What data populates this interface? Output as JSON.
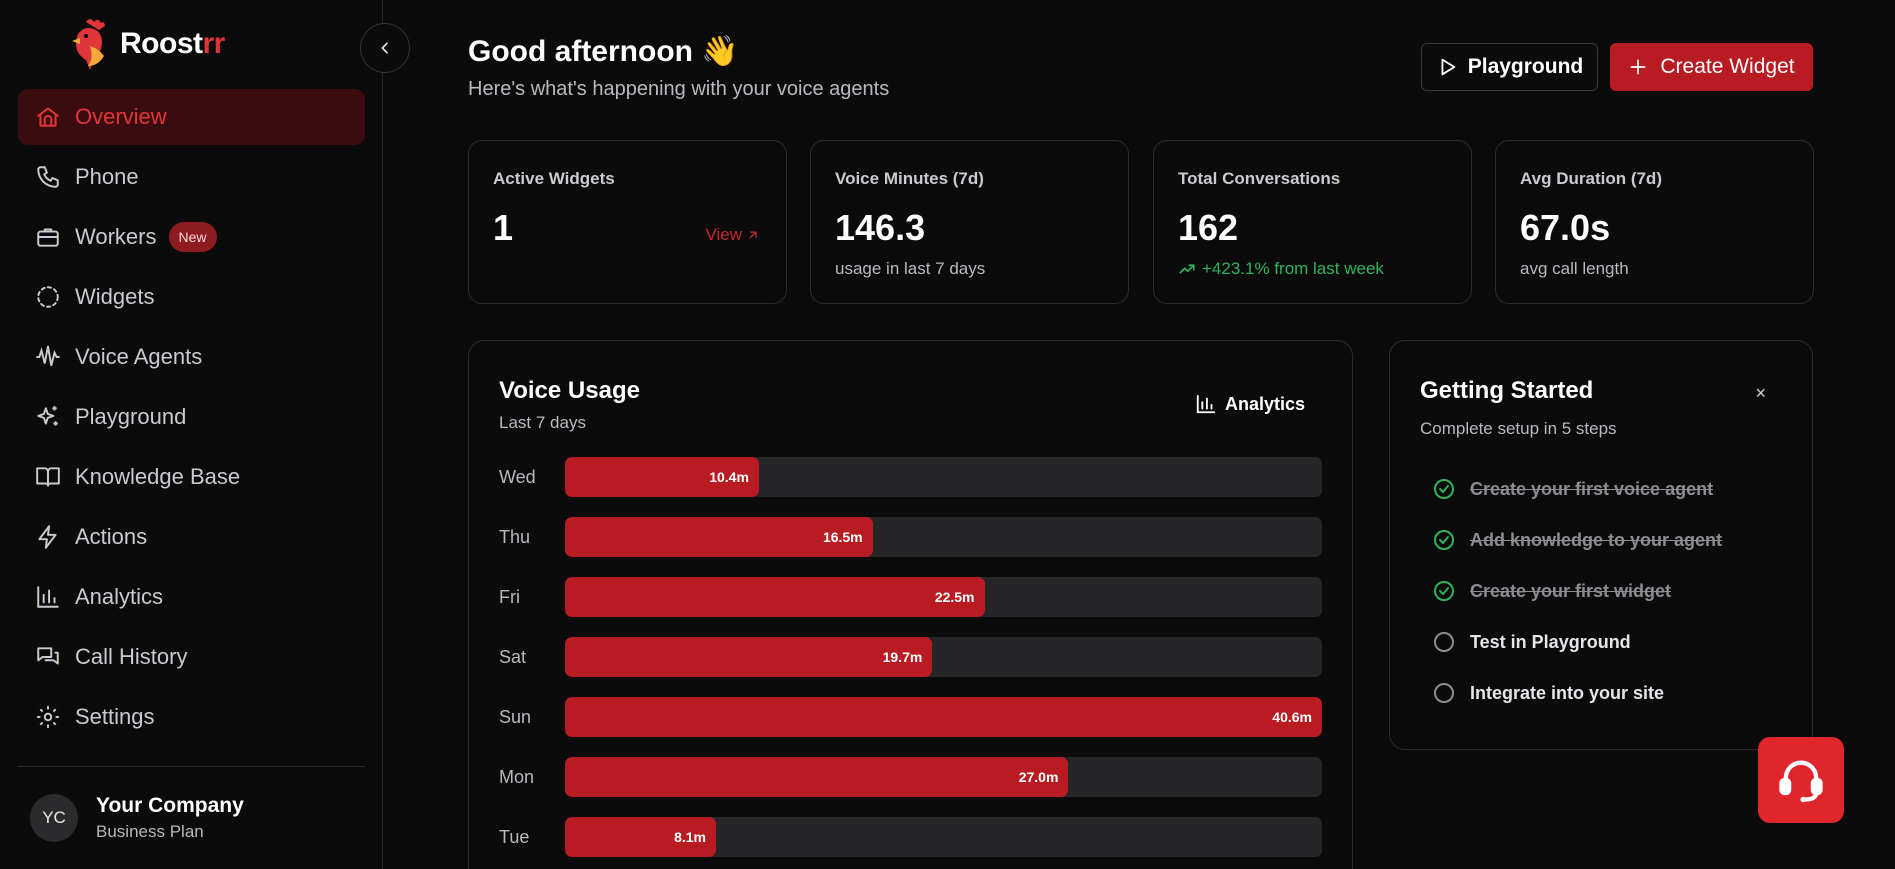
{
  "brand": {
    "name_main": "Roost",
    "name_accent": "rr",
    "accent_color": "#e0353a"
  },
  "sidebar": {
    "items": [
      {
        "label": "Overview",
        "icon": "home-icon",
        "active": true
      },
      {
        "label": "Phone",
        "icon": "phone-icon"
      },
      {
        "label": "Workers",
        "icon": "briefcase-icon",
        "badge": "New"
      },
      {
        "label": "Widgets",
        "icon": "dashed-circle-icon"
      },
      {
        "label": "Voice Agents",
        "icon": "audio-waveform-icon"
      },
      {
        "label": "Playground",
        "icon": "sparkles-icon"
      },
      {
        "label": "Knowledge Base",
        "icon": "book-open-icon"
      },
      {
        "label": "Actions",
        "icon": "lightning-icon"
      },
      {
        "label": "Analytics",
        "icon": "bar-chart-icon"
      },
      {
        "label": "Call History",
        "icon": "messages-icon"
      },
      {
        "label": "Settings",
        "icon": "gear-icon"
      }
    ],
    "account": {
      "initials": "YC",
      "name": "Your Company",
      "plan": "Business Plan"
    }
  },
  "header": {
    "greeting": "Good afternoon 👋",
    "subtitle": "Here's what's happening with your voice agents",
    "playground_label": "Playground",
    "create_label": "Create Widget"
  },
  "stats": [
    {
      "label": "Active Widgets",
      "value": "1",
      "link": "View"
    },
    {
      "label": "Voice Minutes (7d)",
      "value": "146.3",
      "sub": "usage in last 7 days"
    },
    {
      "label": "Total Conversations",
      "value": "162",
      "sub": "+423.1% from last week"
    },
    {
      "label": "Avg Duration (7d)",
      "value": "67.0s",
      "sub": "avg call length"
    }
  ],
  "usage": {
    "title": "Voice Usage",
    "subtitle": "Last 7 days",
    "analytics_label": "Analytics"
  },
  "chart_data": {
    "type": "bar",
    "orientation": "horizontal",
    "categories": [
      "Wed",
      "Thu",
      "Fri",
      "Sat",
      "Sun",
      "Mon",
      "Tue"
    ],
    "values": [
      10.4,
      16.5,
      22.5,
      19.7,
      40.6,
      27.0,
      8.1
    ],
    "value_labels": [
      "10.4m",
      "16.5m",
      "22.5m",
      "19.7m",
      "40.6m",
      "27.0m",
      "8.1m"
    ],
    "max": 40.6,
    "bar_color": "#b81c22",
    "track_color": "#262628"
  },
  "getting_started": {
    "title": "Getting Started",
    "subtitle": "Complete setup in 5 steps",
    "close": "×",
    "steps": [
      {
        "label": "Create your first voice agent",
        "done": true
      },
      {
        "label": "Add knowledge to your agent",
        "done": true
      },
      {
        "label": "Create your first widget",
        "done": true
      },
      {
        "label": "Test in Playground",
        "done": false
      },
      {
        "label": "Integrate into your site",
        "done": false
      }
    ]
  },
  "support": {
    "icon": "headset-icon"
  }
}
